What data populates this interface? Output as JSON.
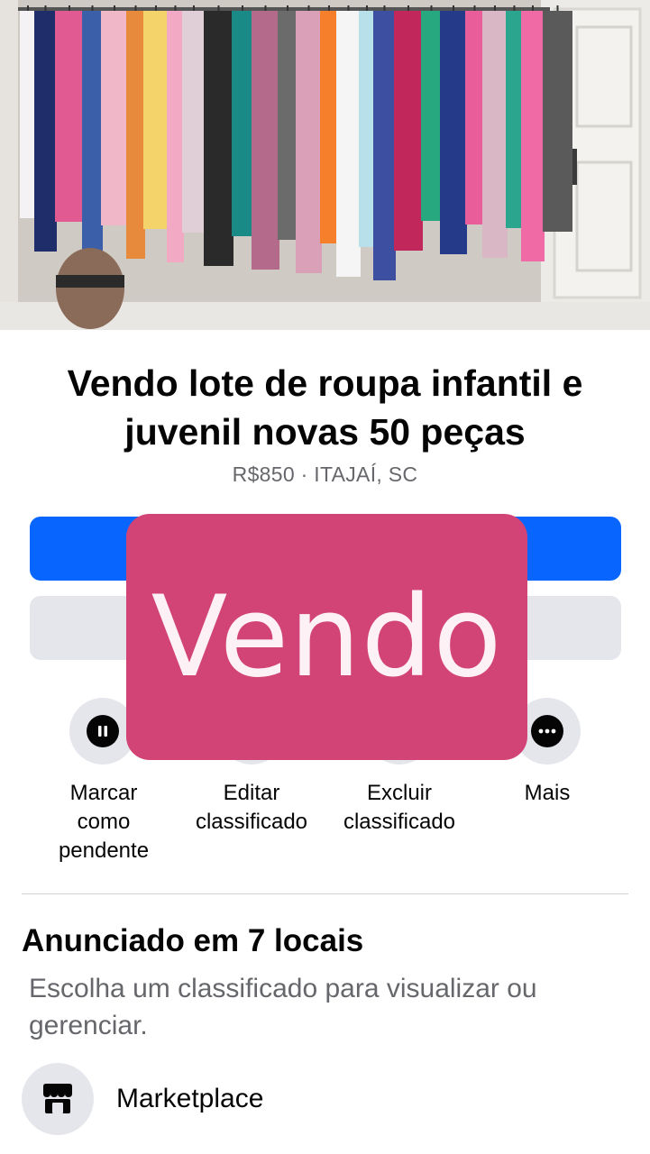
{
  "listing": {
    "title": "Vendo lote de roupa infantil e juvenil novas 50 peças",
    "meta": "R$850 · ITAJAÍ, SC"
  },
  "overlay": {
    "stamp_text": "Vendo",
    "color": "#d34476"
  },
  "buttons": {
    "primary_color": "#0866ff",
    "secondary_color": "#e4e6eb"
  },
  "actions": [
    {
      "label": "Marcar\ncomo\npendente",
      "icon": "pause-icon"
    },
    {
      "label": "Editar\nclassificado",
      "icon": "pencil-icon"
    },
    {
      "label": "Excluir\nclassificado",
      "icon": "trash-icon"
    },
    {
      "label": "Mais",
      "icon": "more-dots-icon"
    }
  ],
  "listed": {
    "title": "Anunciado em 7 locais",
    "description": "Escolha um classificado para visualizar ou gerenciar.",
    "items": [
      {
        "label": "Marketplace",
        "icon": "storefront-icon"
      }
    ]
  }
}
